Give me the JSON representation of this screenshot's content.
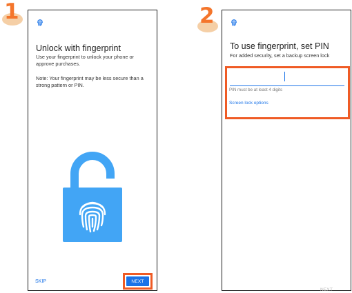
{
  "screens": [
    {
      "step": "1",
      "title": "Unlock with fingerprint",
      "description": "Use your fingerprint to unlock your phone or approve purchases.",
      "note": "Note: Your fingerprint may be less secure than a strong pattern or PIN.",
      "skip_label": "SKIP",
      "next_label": "NEXT",
      "illustration": "fingerprint-padlock",
      "colors": {
        "accent": "#1a73e8",
        "highlight": "#ef5b25",
        "lock": "#42a5f5"
      }
    },
    {
      "step": "2",
      "title": "To use fingerprint, set PIN",
      "description": "For added security, set a backup screen lock",
      "pin_value": "",
      "pin_hint": "PIN must be at least 4 digits",
      "screen_lock_options_label": "Screen lock options",
      "next_label": "NEXT",
      "next_enabled": false
    }
  ],
  "icons": [
    "fingerprint-icon",
    "padlock-fingerprint-illustration"
  ]
}
